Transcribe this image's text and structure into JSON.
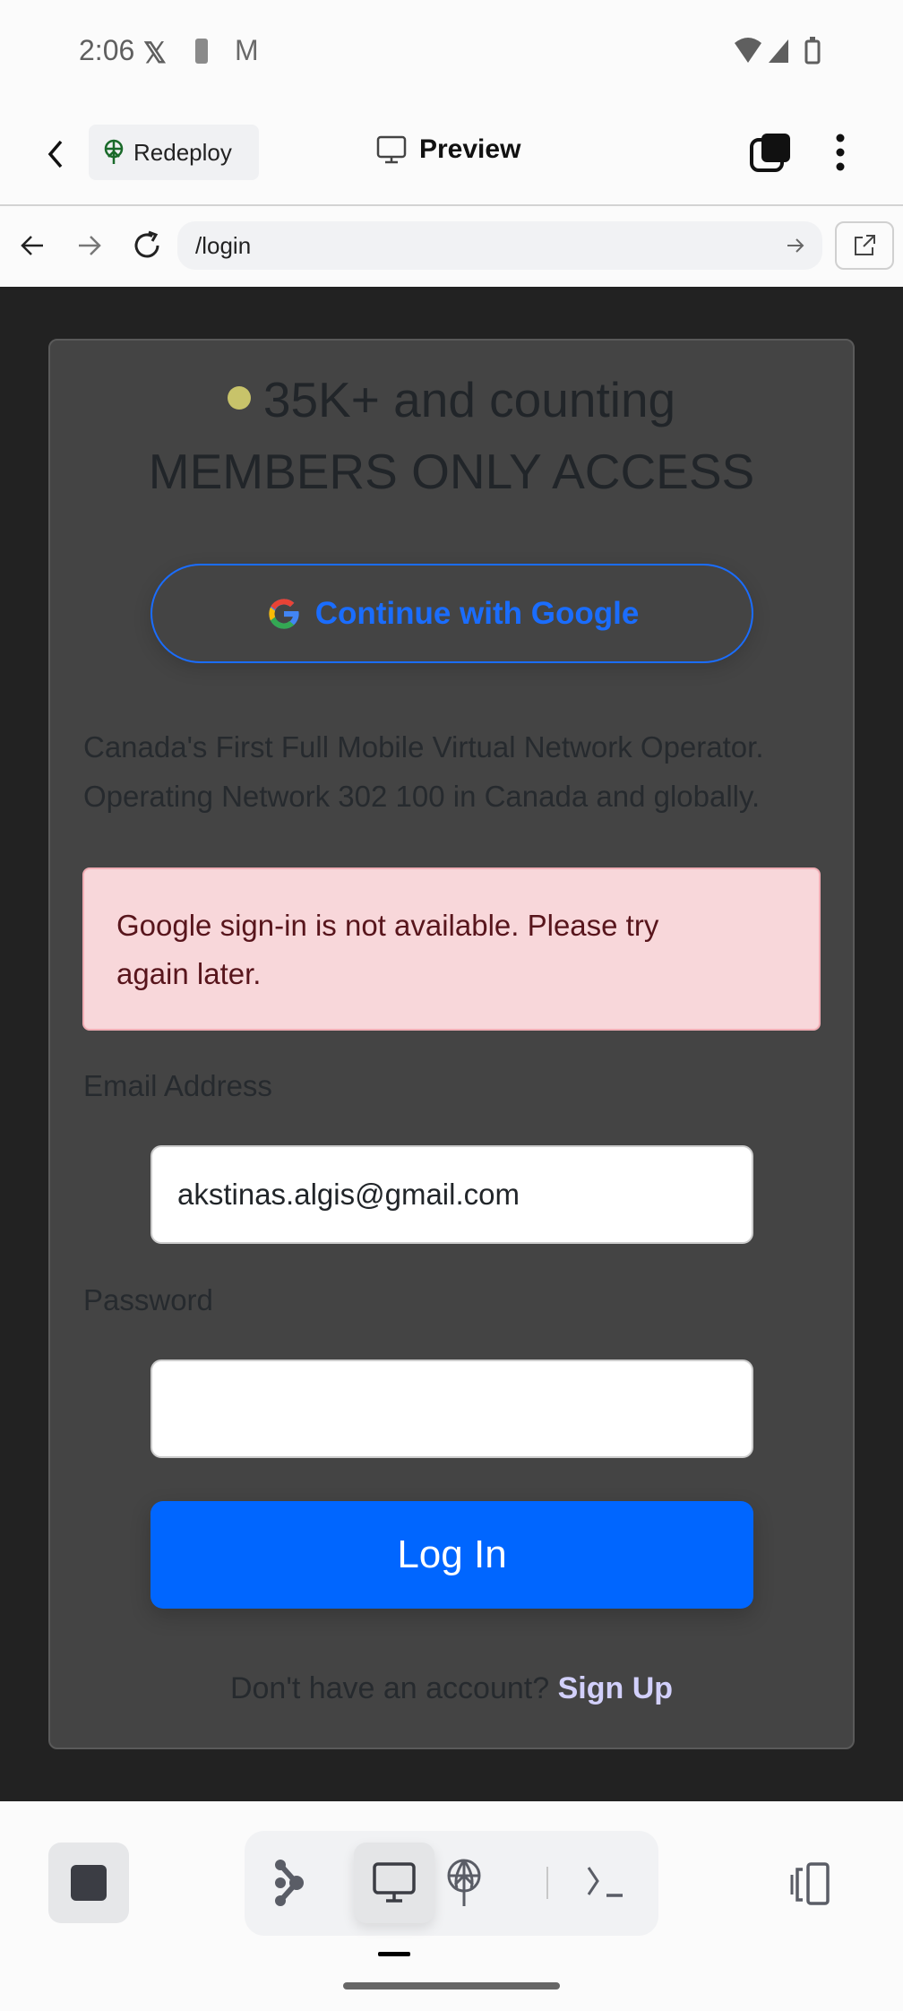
{
  "status_bar": {
    "time": "2:06",
    "icons": [
      "x-icon",
      "battery-saver-icon",
      "gmail-icon",
      "wifi-icon",
      "signal-icon",
      "battery-icon"
    ]
  },
  "toolbar": {
    "redeploy_label": "Redeploy",
    "preview_label": "Preview"
  },
  "browser": {
    "url": "/login"
  },
  "card": {
    "counter": "35K+ and counting",
    "headline": "MEMBERS ONLY ACCESS",
    "google_button": "Continue with Google",
    "description_line1": "Canada's First Full Mobile Virtual Network Operator.",
    "description_line2": "Operating Network 302 100 in Canada and globally.",
    "alert_line1": "Google sign-in is not available. Please try",
    "alert_line2": "again later.",
    "email_label": "Email Address",
    "email_value": "akstinas.algis@gmail.com",
    "password_label": "Password",
    "password_value": "",
    "login_button": "Log In",
    "signup_prompt": "Don't have an account?",
    "signup_link": "Sign Up"
  },
  "colors": {
    "accent": "#0066ff",
    "alert_bg": "#f8d7da",
    "dot": "#c8c36a",
    "signup_link": "#d2d0fb"
  }
}
